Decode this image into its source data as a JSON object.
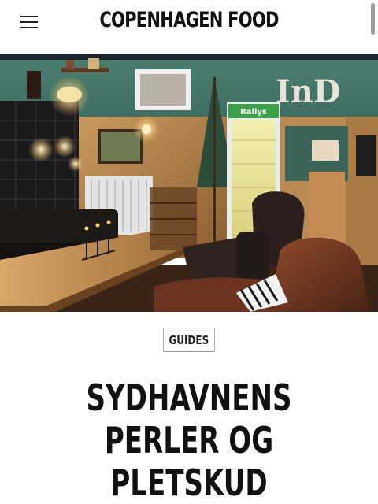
{
  "header": {
    "brand": "COPENHAGEN FOOD",
    "menu_icon": "hamburger-menu-icon"
  },
  "hero": {
    "image": "Café interior with leather armchairs, wooden table, tiled wall and fridge",
    "wall_sign": "InD",
    "fridge_brand": "Rallys"
  },
  "article": {
    "category": "GUIDES",
    "title": "SYDHAVNENS PERLER OG PLETSKUD"
  }
}
